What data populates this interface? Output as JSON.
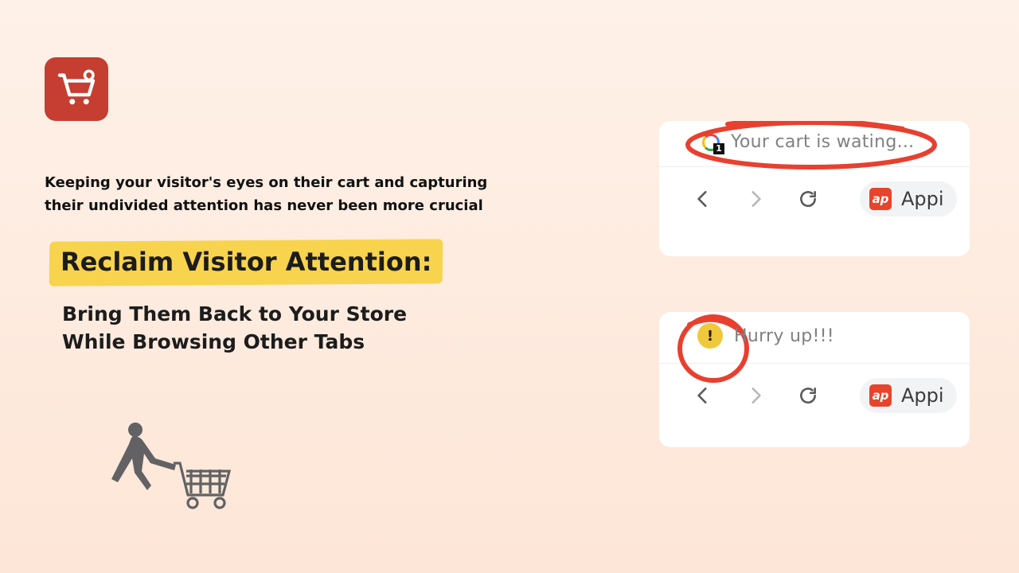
{
  "intro": "Keeping your visitor's eyes on their cart and capturing their undivided attention has never been more crucial",
  "highlight": "Reclaim Visitor Attention:",
  "subhead": "Bring Them Back to Your Store While Browsing Other Tabs",
  "panel1": {
    "badge": "1",
    "tabTitle": "Your cart is wating...",
    "site": "Appi",
    "apIcon": "ap"
  },
  "panel2": {
    "favMark": "!",
    "tabTitle": "Hurry up!!!",
    "site": "Appi",
    "apIcon": "ap"
  }
}
